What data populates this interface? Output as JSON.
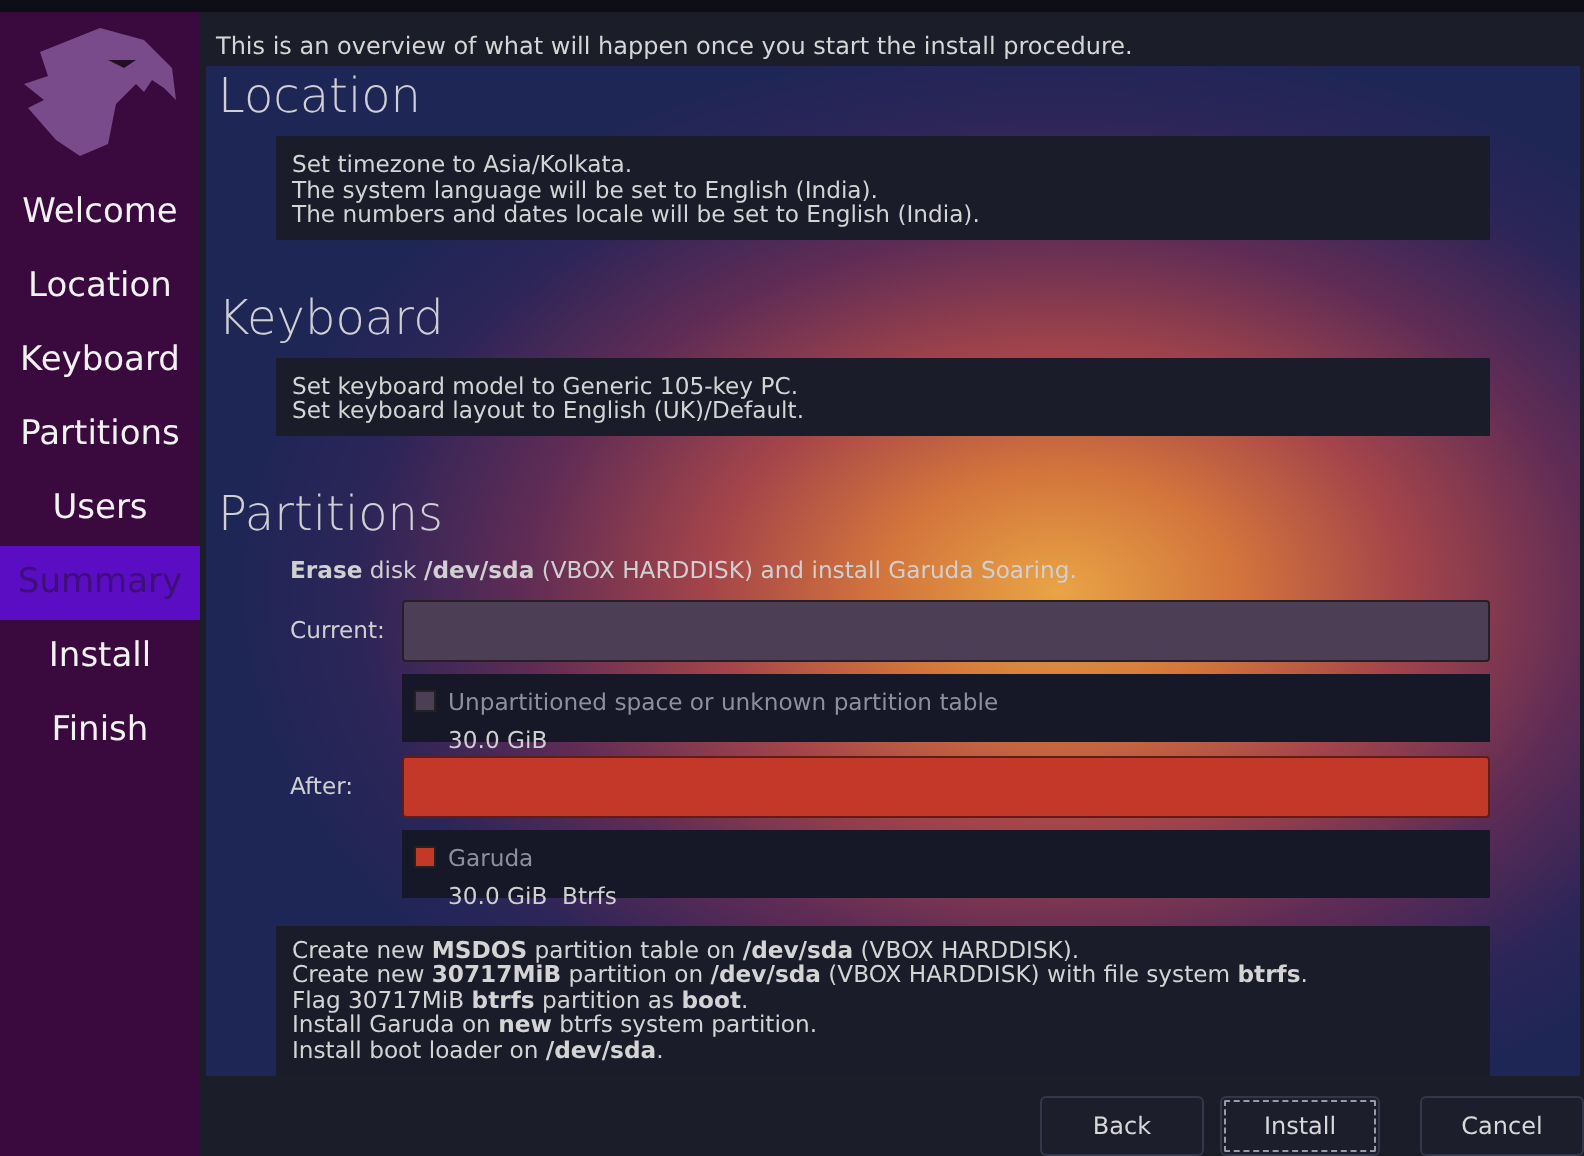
{
  "intro": "This is an overview of what will happen once you start the install procedure.",
  "sidebar": {
    "items": [
      {
        "label": "Welcome",
        "selected": false
      },
      {
        "label": "Location",
        "selected": false
      },
      {
        "label": "Keyboard",
        "selected": false
      },
      {
        "label": "Partitions",
        "selected": false
      },
      {
        "label": "Users",
        "selected": false
      },
      {
        "label": "Summary",
        "selected": true
      },
      {
        "label": "Install",
        "selected": false
      },
      {
        "label": "Finish",
        "selected": false
      }
    ]
  },
  "sections": [
    {
      "kind": "text",
      "heading": "Location",
      "lines": [
        "Set timezone to Asia/Kolkata.",
        "The system language will be set to English (India).",
        "The numbers and dates locale will be set to English (India)."
      ]
    },
    {
      "kind": "text",
      "heading": "Keyboard",
      "lines": [
        "Set keyboard model to Generic 105-key PC.",
        "Set keyboard layout to English (UK)/Default."
      ]
    },
    {
      "kind": "partitions",
      "heading": "Partitions",
      "summary": "**Erase** disk **/dev/sda** (VBOX HARDDISK) and install Garuda Soaring.",
      "layouts": [
        {
          "label": "Current:",
          "color": "#4c3f55",
          "legend": [
            {
              "name": "Unpartitioned space or unknown partition table",
              "details": "30.0 GiB",
              "color": "#4c3f55"
            }
          ]
        },
        {
          "label": "After:",
          "color": "#c4382a",
          "legend": [
            {
              "name": "Garuda",
              "details": "30.0 GiB  Btrfs",
              "color": "#c4382a"
            }
          ]
        }
      ],
      "jobs": [
        "Create new **MSDOS** partition table on **/dev/sda** (VBOX HARDDISK).",
        "Create new **30717MiB** partition on **/dev/sda** (VBOX HARDDISK) with file system **btrfs**.",
        "Flag 30717MiB **btrfs** partition as **boot**.",
        "Install Garuda on **new** btrfs system partition.",
        "Install boot loader on **/dev/sda**."
      ]
    }
  ],
  "buttons": [
    {
      "label": "Back",
      "focused": false
    },
    {
      "label": "Install",
      "focused": true
    },
    {
      "label": "Cancel",
      "focused": false
    }
  ]
}
